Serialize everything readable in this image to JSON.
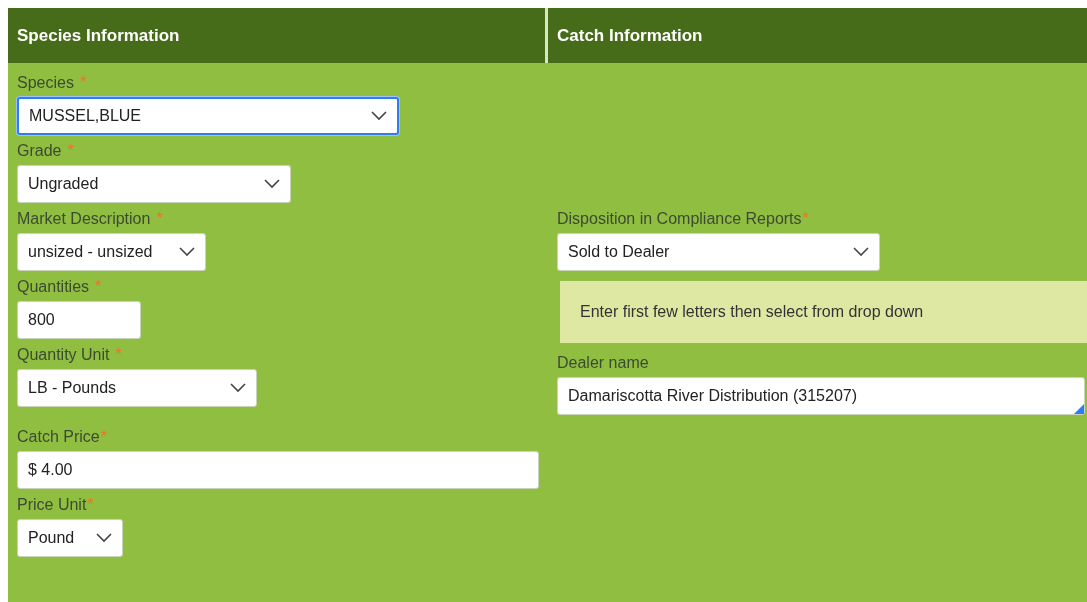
{
  "sections": [
    {
      "title": "Species Information",
      "fields": [
        {
          "kind": "select",
          "label": "Species",
          "required": true,
          "mark": "*",
          "value": "MUSSEL,BLUE",
          "focused": true
        },
        {
          "kind": "select",
          "label": "Grade",
          "required": true,
          "mark": "*",
          "value": "Ungraded",
          "focused": false
        },
        {
          "kind": "select",
          "label": "Market Description",
          "required": true,
          "mark": "*",
          "value": "unsized - unsized",
          "focused": false
        },
        {
          "kind": "input",
          "label": "Quantities",
          "required": true,
          "mark": "*",
          "value": "800",
          "focused": false
        },
        {
          "kind": "select",
          "label": "Quantity Unit",
          "required": true,
          "mark": "*",
          "value": "LB - Pounds",
          "focused": false
        },
        {
          "kind": "input",
          "label": "Catch Price",
          "required": true,
          "mark": "*",
          "value": "$ 4.00",
          "focused": false
        },
        {
          "kind": "select",
          "label": "Price Unit",
          "required": true,
          "mark": "*",
          "value": "Pound",
          "focused": false
        }
      ]
    },
    {
      "title": "Catch Information",
      "fields": [
        {
          "kind": "select",
          "label": "Disposition in Compliance Reports",
          "required": true,
          "mark": "*",
          "value": "Sold to Dealer",
          "focused": false
        },
        {
          "kind": "note",
          "text": "Enter first few letters then select from drop down"
        },
        {
          "kind": "autocomplete",
          "label": "Dealer name",
          "required": false,
          "value": "Damariscotta River Distribution (315207)",
          "focused": false
        }
      ]
    }
  ]
}
